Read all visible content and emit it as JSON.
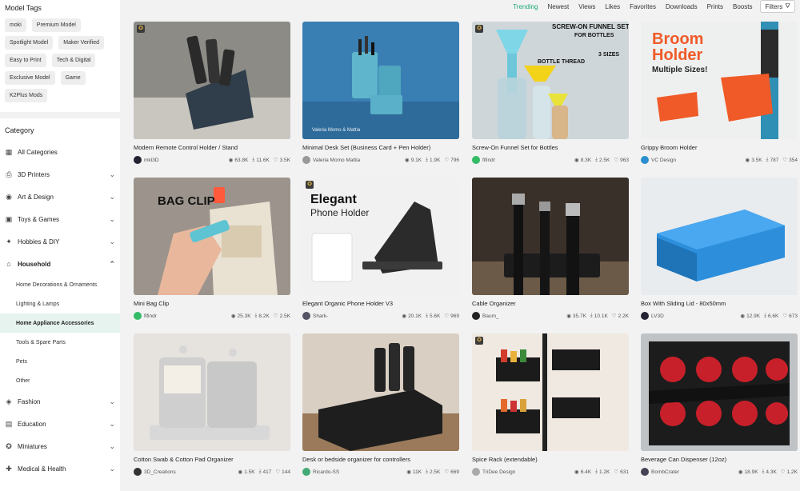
{
  "sidebar": {
    "model_tags_title": "Model Tags",
    "tags": [
      "moki",
      "Premium Model",
      "Spotlight Model",
      "Maker Verified",
      "Easy to Print",
      "Tech & Digital",
      "Exclusive Model",
      "Game",
      "K2Plus Mods"
    ],
    "category_title": "Category",
    "categories": [
      {
        "label": "All Categories",
        "icon": "grid-icon"
      },
      {
        "label": "3D Printers",
        "icon": "printer-icon"
      },
      {
        "label": "Art & Design",
        "icon": "palette-icon"
      },
      {
        "label": "Toys & Games",
        "icon": "toy-icon"
      },
      {
        "label": "Hobbies & DIY",
        "icon": "tools-icon"
      },
      {
        "label": "Household",
        "icon": "home-icon"
      }
    ],
    "subcategories": [
      "Home Decorations & Ornaments",
      "Lighting & Lamps",
      "Home Appliance Accessories",
      "Tools & Spare Parts",
      "Pets",
      "Other"
    ],
    "more_categories": [
      {
        "label": "Fashion",
        "icon": "shirt-icon"
      },
      {
        "label": "Education",
        "icon": "education-icon"
      },
      {
        "label": "Miniatures",
        "icon": "miniature-icon"
      },
      {
        "label": "Medical & Health",
        "icon": "medical-icon"
      }
    ]
  },
  "topbar": {
    "sorts": [
      "Trending",
      "Newest",
      "Views",
      "Likes",
      "Favorites",
      "Downloads",
      "Prints",
      "Boosts"
    ],
    "filters_label": "Filters"
  },
  "cards": [
    {
      "title": "Modern Remote Control Holder / Stand",
      "author": "mkl3D",
      "views": "63.8K",
      "downloads": "11.6K",
      "likes": "3.5K"
    },
    {
      "title": "Minimal Desk Set (Business Card + Pen Holder)",
      "author": "Valeria Momo Mattia",
      "views": "9.1K",
      "downloads": "1.9K",
      "likes": "796"
    },
    {
      "title": "Screw-On Funnel Set for Bottles",
      "author": "fifindr",
      "views": "8.3K",
      "downloads": "2.5K",
      "likes": "963"
    },
    {
      "title": "Grippy Broom Holder",
      "author": "VC Design",
      "views": "3.5K",
      "downloads": "787",
      "likes": "354"
    },
    {
      "title": "Mini Bag Clip",
      "author": "fifindr",
      "views": "25.3K",
      "downloads": "8.2K",
      "likes": "2.5K"
    },
    {
      "title": "Elegant Organic Phone Holder V3",
      "author": "Shark-",
      "views": "20.1K",
      "downloads": "5.6K",
      "likes": "969"
    },
    {
      "title": "Cable Organizer",
      "author": "Baum_",
      "views": "35.7K",
      "downloads": "10.1K",
      "likes": "2.2K"
    },
    {
      "title": "Box With Sliding Lid - 80x50mm",
      "author": "LV3D",
      "views": "12.9K",
      "downloads": "6.6K",
      "likes": "673"
    },
    {
      "title": "Cotton Swab & Cotton Pad Organizer",
      "author": "3D_Creations",
      "views": "1.5K",
      "downloads": "417",
      "likes": "144"
    },
    {
      "title": "Desk or bedside organizer for controllers",
      "author": "Ricardo-SS",
      "views": "11K",
      "downloads": "2.5K",
      "likes": "669"
    },
    {
      "title": "Spice Rack (extendable)",
      "author": "TriDee Design",
      "views": "6.4K",
      "downloads": "1.2K",
      "likes": "631"
    },
    {
      "title": "Beverage Can Dispenser (12oz)",
      "author": "BombCrater",
      "views": "18.9K",
      "downloads": "4.3K",
      "likes": "1.2K"
    }
  ],
  "thumb_text": {
    "funnel_title": "SCREW-ON FUNNEL SET",
    "funnel_sub": "FOR BOTTLES",
    "funnel_thread": "BOTTLE THREAD",
    "funnel_sizes": "3 SIZES",
    "broom_line1": "Broom",
    "broom_line2": "Holder",
    "broom_sub": "Multiple Sizes!",
    "bagclip": "BAG CLIP",
    "phone_line1": "Elegant",
    "phone_line2": "Phone Holder",
    "desk_credit": "Valeria Momo & Mattia"
  },
  "colors": {
    "accent": "#1aaa73",
    "broom_orange": "#f05a28"
  }
}
